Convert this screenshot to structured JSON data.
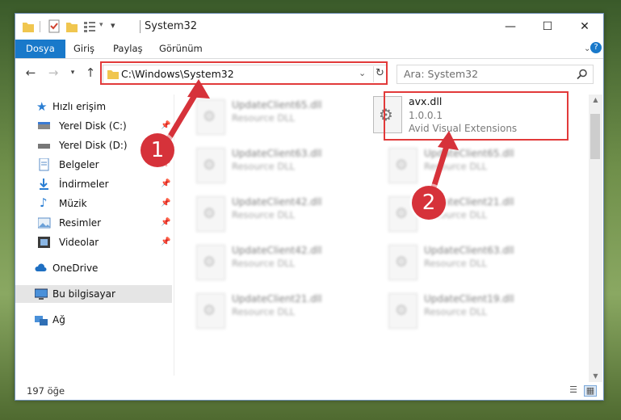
{
  "window": {
    "title": "System32"
  },
  "titlebar": {
    "minimize_icon": "minimize-icon",
    "maximize_icon": "maximize-icon",
    "close_icon": "close-icon"
  },
  "ribbon": {
    "tabs": [
      "Dosya",
      "Giriş",
      "Paylaş",
      "Görünüm"
    ]
  },
  "address": {
    "path": "C:\\Windows\\System32",
    "search_placeholder": "Ara: System32"
  },
  "nav": {
    "items": [
      {
        "label": "Hızlı erişim",
        "icon": "star-icon"
      },
      {
        "label": "Yerel Disk (C:)",
        "icon": "drive-icon",
        "pinned": true
      },
      {
        "label": "Yerel Disk (D:)",
        "icon": "drive-icon",
        "pinned": true
      },
      {
        "label": "Belgeler",
        "icon": "documents-icon",
        "pinned": true
      },
      {
        "label": "İndirmeler",
        "icon": "downloads-icon",
        "pinned": true
      },
      {
        "label": "Müzik",
        "icon": "music-icon",
        "pinned": true
      },
      {
        "label": "Resimler",
        "icon": "pictures-icon",
        "pinned": true
      },
      {
        "label": "Videolar",
        "icon": "videos-icon",
        "pinned": true
      },
      {
        "label": "OneDrive",
        "icon": "cloud-icon"
      },
      {
        "label": "Bu bilgisayar",
        "icon": "computer-icon",
        "selected": true
      },
      {
        "label": "Ağ",
        "icon": "network-icon"
      }
    ]
  },
  "files": {
    "blurred": [
      {
        "name": "UpdateClient65.dll",
        "desc": "Resource DLL"
      },
      {
        "name": "UpdateClient63.dll",
        "desc": "Resource DLL"
      },
      {
        "name": "UpdateClient65.dll",
        "desc": "Resource DLL"
      },
      {
        "name": "UpdateClient42.dll",
        "desc": "Resource DLL"
      },
      {
        "name": "UpdateClient21.dll",
        "desc": "Resource DLL"
      },
      {
        "name": "UpdateClient42.dll",
        "desc": "Resource DLL"
      },
      {
        "name": "UpdateClient63.dll",
        "desc": "Resource DLL"
      },
      {
        "name": "UpdateClient21.dll",
        "desc": "Resource DLL"
      },
      {
        "name": "UpdateClient19.dll",
        "desc": "Resource DLL"
      }
    ],
    "highlighted": {
      "name": "avx.dll",
      "version": "1.0.0.1",
      "desc": "Avid Visual Extensions"
    }
  },
  "annotations": {
    "badge1": "1",
    "badge2": "2",
    "color": "#d6323a"
  },
  "status": {
    "count": "197 öğe"
  }
}
